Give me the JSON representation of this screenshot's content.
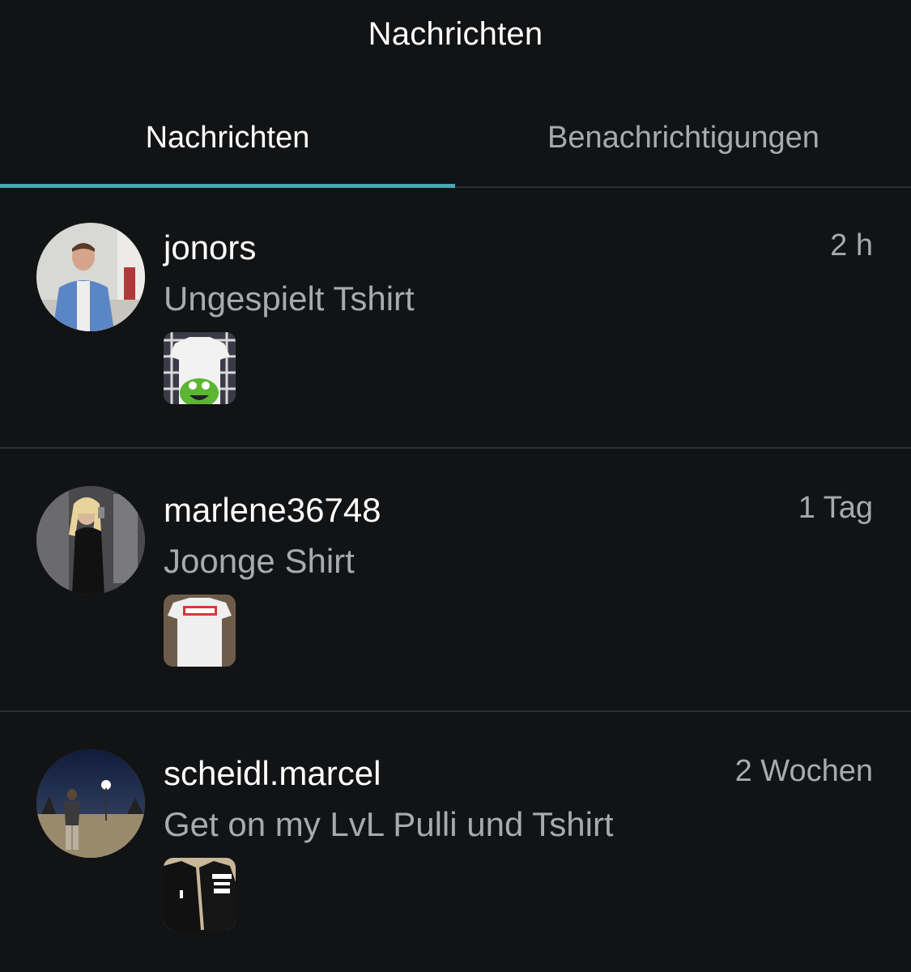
{
  "header": {
    "title": "Nachrichten"
  },
  "tabs": [
    {
      "label": "Nachrichten",
      "active": true
    },
    {
      "label": "Benachrichtigungen",
      "active": false
    }
  ],
  "accent_color": "#49a6b5",
  "conversations": [
    {
      "username": "jonors",
      "subject": "Ungespielt Tshirt",
      "time": "2 h",
      "avatar_icon": "user-avatar-photo",
      "thumbnail_icon": "tshirt-photo-green-monster"
    },
    {
      "username": "marlene36748",
      "subject": "Joonge Shirt",
      "time": "1 Tag",
      "avatar_icon": "user-avatar-photo",
      "thumbnail_icon": "tshirt-photo-joonge"
    },
    {
      "username": "scheidl.marcel",
      "subject": "Get on my LvL Pulli und Tshirt",
      "time": "2 Wochen",
      "avatar_icon": "user-avatar-photo",
      "thumbnail_icon": "hoodie-tshirt-photo-black"
    }
  ]
}
